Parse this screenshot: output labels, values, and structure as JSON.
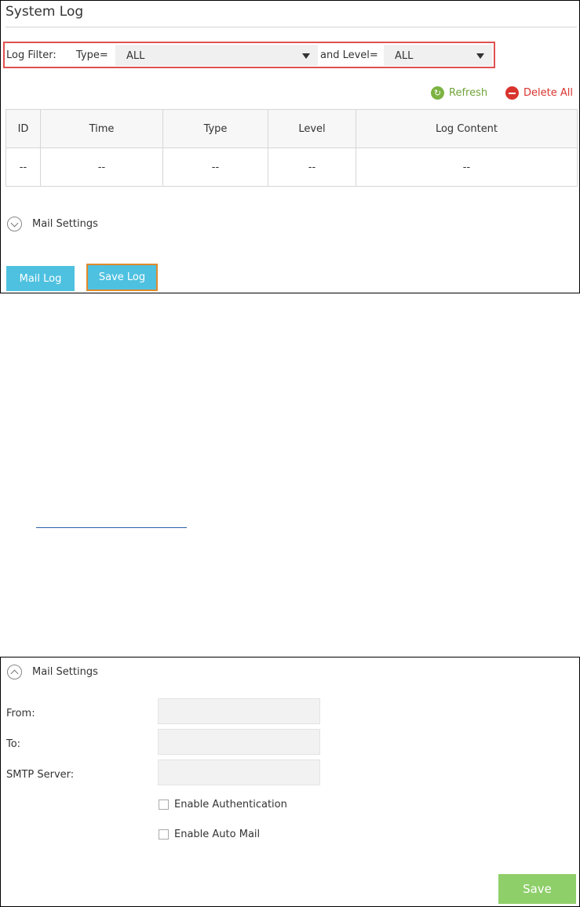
{
  "system_log": {
    "title": "System Log",
    "filter": {
      "label": "Log Filter:",
      "type_label": "Type=",
      "type_value": "ALL",
      "level_label": "and Level=",
      "level_value": "ALL"
    },
    "actions": {
      "refresh": "Refresh",
      "delete_all": "Delete All"
    },
    "table": {
      "headers": [
        "ID",
        "Time",
        "Type",
        "Level",
        "Log Content"
      ],
      "rows": [
        [
          "--",
          "--",
          "--",
          "--",
          "--"
        ]
      ]
    },
    "mail_settings_label": "Mail Settings",
    "buttons": {
      "mail_log": "Mail Log",
      "save_log": "Save Log"
    }
  },
  "mail_settings": {
    "label": "Mail Settings",
    "fields": {
      "from": "From:",
      "to": "To:",
      "smtp": "SMTP Server:"
    },
    "checkboxes": {
      "auth": "Enable Authentication",
      "auto_mail": "Enable Auto Mail"
    },
    "save": "Save"
  },
  "colors": {
    "accent_blue": "#4ec1e0",
    "refresh_green": "#7cb342",
    "delete_red": "#d9332e",
    "save_green": "#8fcf6a",
    "highlight_red": "#e05050",
    "highlight_orange": "#e08a2c"
  }
}
